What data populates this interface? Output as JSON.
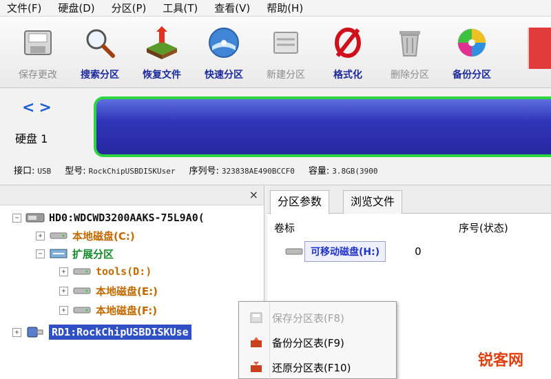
{
  "menubar": {
    "items": [
      "文件(F)",
      "硬盘(D)",
      "分区(P)",
      "工具(T)",
      "查看(V)",
      "帮助(H)"
    ]
  },
  "toolbar": {
    "buttons": [
      {
        "label": "保存更改",
        "icon": "save-changes-icon",
        "enabled": false
      },
      {
        "label": "搜索分区",
        "icon": "search-partition-icon",
        "enabled": true
      },
      {
        "label": "恢复文件",
        "icon": "recover-files-icon",
        "enabled": true
      },
      {
        "label": "快速分区",
        "icon": "quick-partition-icon",
        "enabled": true
      },
      {
        "label": "新建分区",
        "icon": "new-partition-icon",
        "enabled": false
      },
      {
        "label": "格式化",
        "icon": "format-icon",
        "enabled": true
      },
      {
        "label": "删除分区",
        "icon": "delete-partition-icon",
        "enabled": false
      },
      {
        "label": "备份分区",
        "icon": "backup-partition-icon",
        "enabled": true
      }
    ]
  },
  "diskbar": {
    "nav_back": "<",
    "nav_forward": ">",
    "disk_label": "硬盘 1",
    "interface_label": "接口:",
    "interface_value": "USB",
    "model_label": "型号:",
    "model_value": "RockChipUSBDISKUser",
    "serial_label": "序列号:",
    "serial_value": "323838AE490BCCF0",
    "capacity_label": "容量:",
    "capacity_value": "3.8GB(3900",
    "bar_color": "#2f35b8",
    "bar_border": "#2bd63e"
  },
  "tree": {
    "close": "×",
    "nodes": [
      {
        "text": "HD0:WDCWD3200AAKS-75L9A0(",
        "level": 0,
        "expander": "−",
        "style": "dark"
      },
      {
        "text": "本地磁盘(C:)",
        "level": 1,
        "expander": "+",
        "style": "orange"
      },
      {
        "text": "扩展分区",
        "level": 1,
        "expander": "−",
        "style": "green"
      },
      {
        "text": "tools(D:)",
        "level": 2,
        "expander": "+",
        "style": "orange"
      },
      {
        "text": "本地磁盘(E:)",
        "level": 2,
        "expander": "+",
        "style": "orange"
      },
      {
        "text": "本地磁盘(F:)",
        "level": 2,
        "expander": "+",
        "style": "orange"
      },
      {
        "text": "RD1:RockChipUSBDISKUse",
        "level": 0,
        "expander": "+",
        "style": "selected"
      }
    ]
  },
  "rightpanel": {
    "tabs": [
      "分区参数",
      "浏览文件"
    ],
    "columns": {
      "label": "卷标",
      "seq": "序号(状态)"
    },
    "rows": [
      {
        "label": "可移动磁盘(H:)",
        "seq": "0"
      }
    ]
  },
  "contextmenu": {
    "items": [
      {
        "label": "保存分区表(F8)",
        "icon": "save-table-icon",
        "enabled": false
      },
      {
        "label": "备份分区表(F9)",
        "icon": "backup-table-icon",
        "enabled": true
      },
      {
        "label": "还原分区表(F10)",
        "icon": "restore-table-icon",
        "enabled": true
      }
    ]
  },
  "watermark": "锐客网"
}
